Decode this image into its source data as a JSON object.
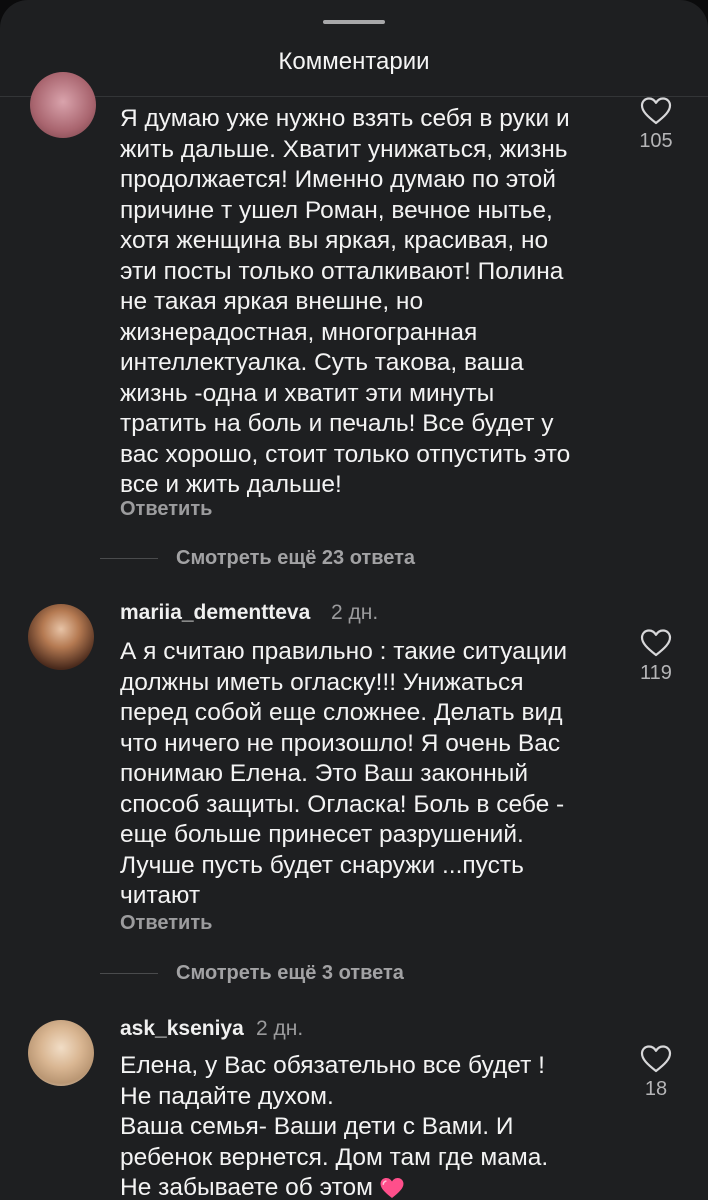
{
  "header": {
    "title": "Комментарии"
  },
  "comments": [
    {
      "username": "",
      "timestamp": "",
      "text": "Я думаю уже нужно взять себя в руки и\nжить дальше. Хватит унижаться, жизнь\nпродолжается! Именно думаю по этой\nпричине т ушел Роман, вечное нытье,\nхотя женщина вы яркая, красивая, но\nэти посты только отталкивают! Полина\nне такая яркая внешне, но\nжизнерадостная, многогранная\nинтеллектуалка. Суть такова, ваша\nжизнь -одна и хватит эти минуты\nтратить на боль и печаль! Все будет у\nвас хорошо, стоит только отпустить это\nвсе и жить дальше!",
      "reply_label": "Ответить",
      "likes": "105",
      "more_replies": "Смотреть ещё 23 ответа"
    },
    {
      "username": "mariia_dementteva",
      "timestamp": "2 дн.",
      "text": "А я считаю правильно : такие ситуации\nдолжны иметь огласку!!! Унижаться\nперед собой еще сложнее. Делать вид\nчто ничего не произошло! Я очень Вас\nпонимаю Елена. Это Ваш законный\nспособ защиты. Огласка! Боль в себе -\nеще больше принесет разрушений.\nЛучше пусть будет снаружи ...пусть\nчитают",
      "reply_label": "Ответить",
      "likes": "119",
      "more_replies": "Смотреть ещё 3 ответа"
    },
    {
      "username": "ask_kseniya",
      "timestamp": "2 дн.",
      "text": "Елена, у Вас обязательно все будет !\nНе падайте духом.\nВаша семья- Ваши дети с Вами. И\nребенок вернется. Дом там где мама.\nНе забываете об этом",
      "likes": "18"
    }
  ],
  "colors": {
    "sheet_bg": "#1e1f21",
    "text_primary": "#f3f3f3",
    "text_secondary": "#9c9c9e",
    "emoji_heart": "#ff4f8b"
  },
  "icons": {
    "like": "heart-outline-icon",
    "emoji": "pink-heart-emoji"
  }
}
